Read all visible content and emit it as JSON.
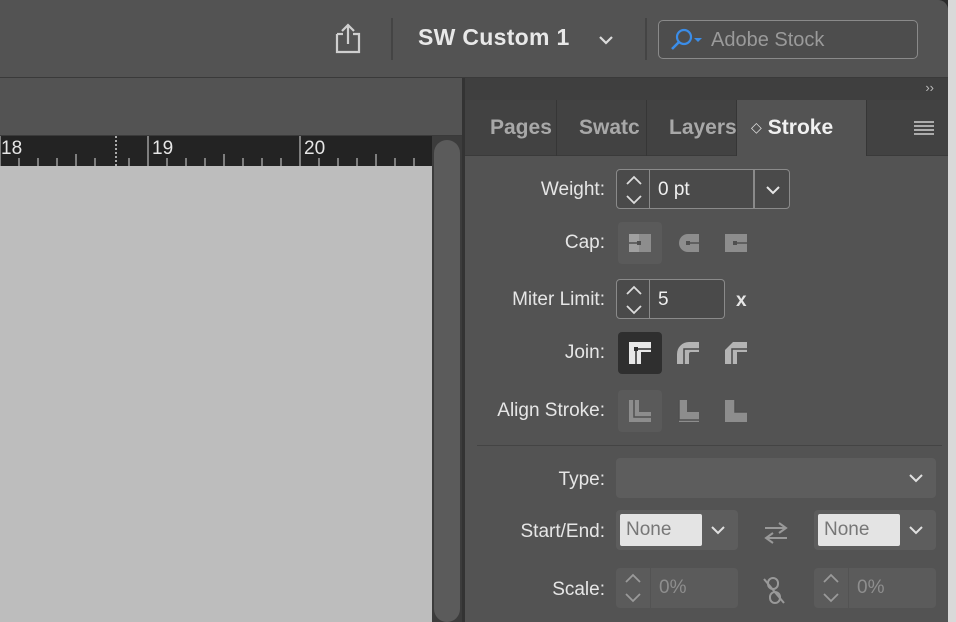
{
  "topbar": {
    "workspace_label": "SW Custom 1",
    "search_placeholder": "Adobe Stock"
  },
  "ruler": {
    "labels": [
      "18",
      "19",
      "20"
    ]
  },
  "panel": {
    "collapse_label": "››",
    "tabs": [
      {
        "label": "Pages"
      },
      {
        "label": "Swatc"
      },
      {
        "label": "Layers"
      },
      {
        "label": "Stroke"
      }
    ],
    "active_tab_arrow": "◇",
    "weight": {
      "label": "Weight:",
      "value": "0 pt"
    },
    "cap": {
      "label": "Cap:"
    },
    "miter": {
      "label": "Miter Limit:",
      "value": "5",
      "unit": "x"
    },
    "join": {
      "label": "Join:"
    },
    "align": {
      "label": "Align Stroke:"
    },
    "type": {
      "label": "Type:",
      "value": ""
    },
    "start_end": {
      "label": "Start/End:",
      "start": "None",
      "end": "None"
    },
    "scale": {
      "label": "Scale:",
      "start": "0%",
      "end": "0%"
    }
  }
}
